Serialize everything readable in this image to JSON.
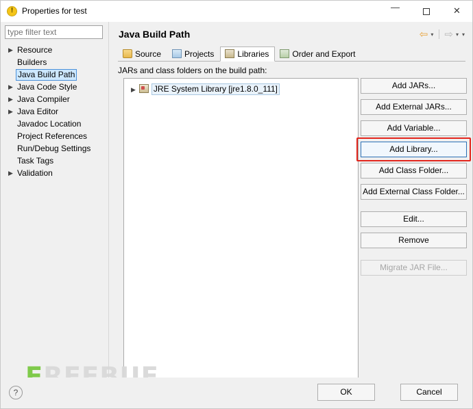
{
  "window": {
    "title": "Properties for test",
    "icon": "warning-icon",
    "minimize": "—",
    "maximize": "□",
    "close": "✕"
  },
  "sidebar": {
    "filter_placeholder": "type filter text",
    "items": [
      {
        "label": "Resource",
        "expandable": true,
        "selected": false
      },
      {
        "label": "Builders",
        "expandable": false,
        "selected": false
      },
      {
        "label": "Java Build Path",
        "expandable": false,
        "selected": true
      },
      {
        "label": "Java Code Style",
        "expandable": true,
        "selected": false
      },
      {
        "label": "Java Compiler",
        "expandable": true,
        "selected": false
      },
      {
        "label": "Java Editor",
        "expandable": true,
        "selected": false
      },
      {
        "label": "Javadoc Location",
        "expandable": false,
        "selected": false
      },
      {
        "label": "Project References",
        "expandable": false,
        "selected": false
      },
      {
        "label": "Run/Debug Settings",
        "expandable": false,
        "selected": false
      },
      {
        "label": "Task Tags",
        "expandable": false,
        "selected": false
      },
      {
        "label": "Validation",
        "expandable": true,
        "selected": false
      }
    ]
  },
  "page": {
    "title": "Java Build Path",
    "nav": {
      "back": "⇦",
      "back_caret": "▾",
      "forward": "⇨",
      "forward_caret": "▾",
      "menu_caret": "▾"
    },
    "tabs": [
      {
        "label": "Source",
        "icon": "source-folder-icon",
        "active": false
      },
      {
        "label": "Projects",
        "icon": "projects-icon",
        "active": false
      },
      {
        "label": "Libraries",
        "icon": "libraries-icon",
        "active": true
      },
      {
        "label": "Order and Export",
        "icon": "order-export-icon",
        "active": false
      }
    ],
    "list_label": "JARs and class folders on the build path:",
    "tree": [
      {
        "label": "JRE System Library [jre1.8.0_111]",
        "icon": "library-icon",
        "expandable": true
      }
    ],
    "buttons": [
      {
        "label": "Add JARs...",
        "disabled": false,
        "highlighted": false
      },
      {
        "label": "Add External JARs...",
        "disabled": false,
        "highlighted": false
      },
      {
        "label": "Add Variable...",
        "disabled": false,
        "highlighted": false
      },
      {
        "label": "Add Library...",
        "disabled": false,
        "highlighted": true
      },
      {
        "label": "Add Class Folder...",
        "disabled": false,
        "highlighted": false
      },
      {
        "label": "Add External Class Folder...",
        "disabled": false,
        "highlighted": false
      },
      {
        "label": "Edit...",
        "disabled": false,
        "highlighted": false,
        "gap_above": true
      },
      {
        "label": "Remove",
        "disabled": false,
        "highlighted": false
      },
      {
        "label": "Migrate JAR File...",
        "disabled": true,
        "highlighted": false,
        "gap_above": true
      }
    ]
  },
  "footer": {
    "help": "?",
    "ok": "OK",
    "cancel": "Cancel"
  },
  "watermark": {
    "prefix": "F",
    "text": "REEBUF"
  },
  "colors": {
    "highlight_red": "#e2231a",
    "selection_blue": "#cde8ff",
    "accent_green": "#7ac943"
  }
}
